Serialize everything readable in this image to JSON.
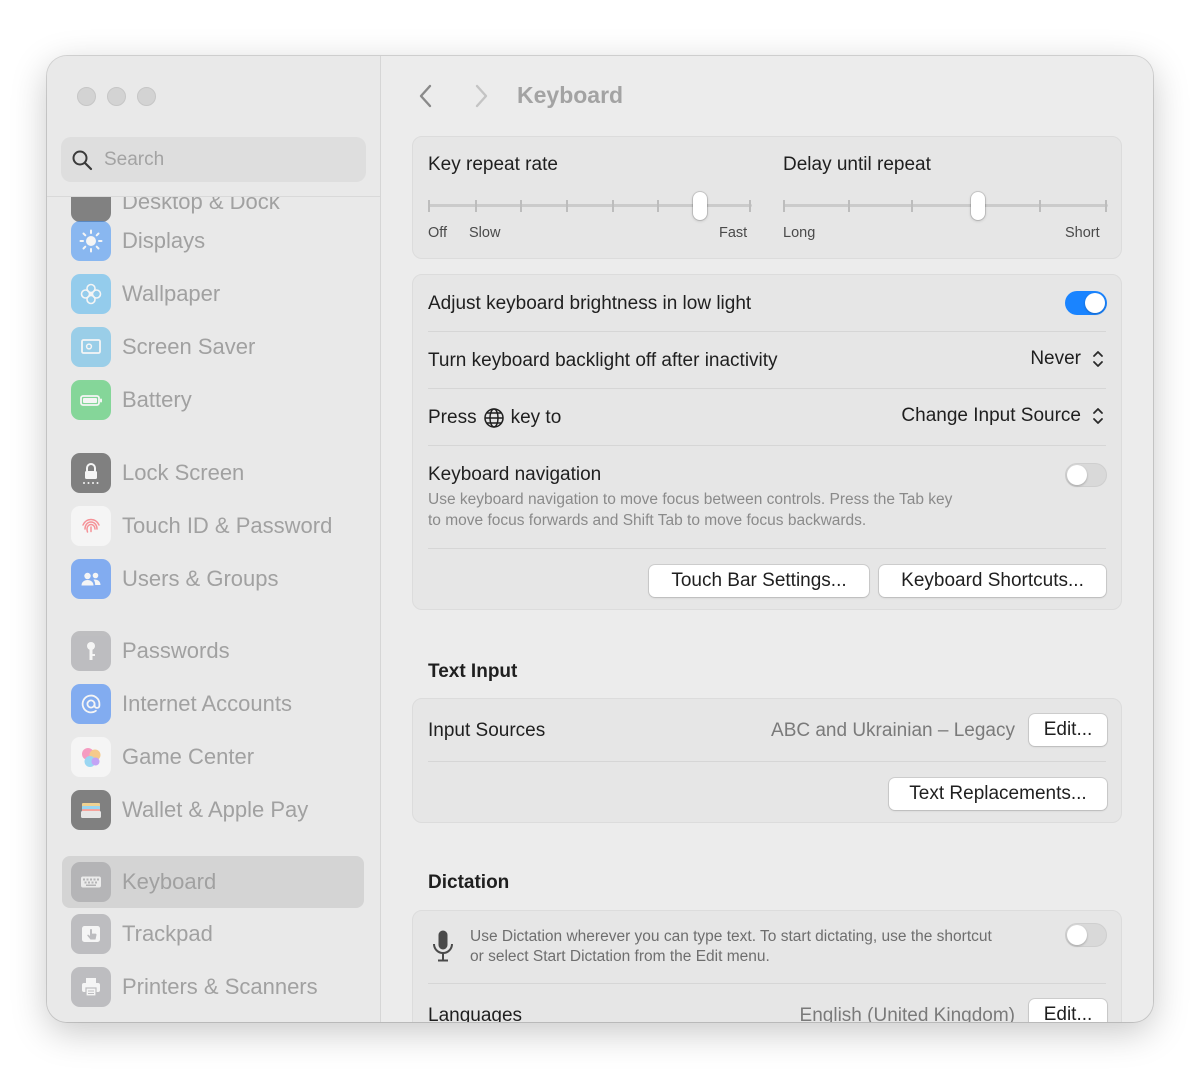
{
  "sidebar": {
    "search_placeholder": "Search",
    "partial_top_item": "Desktop & Dock",
    "items": [
      {
        "label": "Displays",
        "icon": "sun-icon",
        "color": "#3b8ff6"
      },
      {
        "label": "Wallpaper",
        "icon": "flower-icon",
        "color": "#4fb6f0"
      },
      {
        "label": "Screen Saver",
        "icon": "screensaver-icon",
        "color": "#5ab8e8"
      },
      {
        "label": "Battery",
        "icon": "battery-icon",
        "color": "#34c759"
      },
      {
        "label": "Lock Screen",
        "icon": "lock-icon",
        "color": "#2b2b2b"
      },
      {
        "label": "Touch ID & Password",
        "icon": "fingerprint-icon",
        "color": "#ff5a5f"
      },
      {
        "label": "Users & Groups",
        "icon": "users-icon",
        "color": "#2f7cf6"
      },
      {
        "label": "Passwords",
        "icon": "key-icon",
        "color": "#8e8e93"
      },
      {
        "label": "Internet Accounts",
        "icon": "at-icon",
        "color": "#2f7cf6"
      },
      {
        "label": "Game Center",
        "icon": "game-center-icon",
        "color": "#ff6b9a"
      },
      {
        "label": "Wallet & Apple Pay",
        "icon": "wallet-icon",
        "color": "#2b2b2b"
      },
      {
        "label": "Keyboard",
        "icon": "keyboard-icon",
        "color": "#8e8e93"
      },
      {
        "label": "Trackpad",
        "icon": "trackpad-icon",
        "color": "#8e8e93"
      },
      {
        "label": "Printers & Scanners",
        "icon": "printer-icon",
        "color": "#8e8e93"
      }
    ],
    "selected": "Keyboard"
  },
  "header": {
    "title": "Keyboard"
  },
  "repeat": {
    "key_repeat_label": "Key repeat rate",
    "key_repeat_ticks": [
      "Off",
      "Slow",
      "Fast"
    ],
    "key_repeat_value_fraction": 0.84,
    "delay_label": "Delay until repeat",
    "delay_ticks": [
      "Long",
      "Short"
    ],
    "delay_value_fraction": 0.6
  },
  "settings": {
    "brightness_label": "Adjust keyboard brightness in low light",
    "brightness_on": true,
    "backlight_label": "Turn keyboard backlight off after inactivity",
    "backlight_value": "Never",
    "press_prefix": "Press",
    "press_suffix": "key to",
    "press_value": "Change Input Source",
    "nav_label": "Keyboard navigation",
    "nav_desc_1": "Use keyboard navigation to move focus between controls. Press the Tab key",
    "nav_desc_2": "to move focus forwards and Shift Tab to move focus backwards.",
    "nav_on": false,
    "touchbar_button": "Touch Bar Settings...",
    "shortcuts_button": "Keyboard Shortcuts..."
  },
  "text_input": {
    "header": "Text Input",
    "sources_label": "Input Sources",
    "sources_value": "ABC and Ukrainian – Legacy",
    "edit_button": "Edit...",
    "replacements_button": "Text Replacements..."
  },
  "dictation": {
    "header": "Dictation",
    "desc_1": "Use Dictation wherever you can type text. To start dictating, use the shortcut",
    "desc_2": "or select Start Dictation from the Edit menu.",
    "on": false,
    "languages_label": "Languages",
    "languages_value": "English (United Kingdom)",
    "edit_button": "Edit..."
  },
  "colors": {
    "accent": "#1a84ff"
  }
}
